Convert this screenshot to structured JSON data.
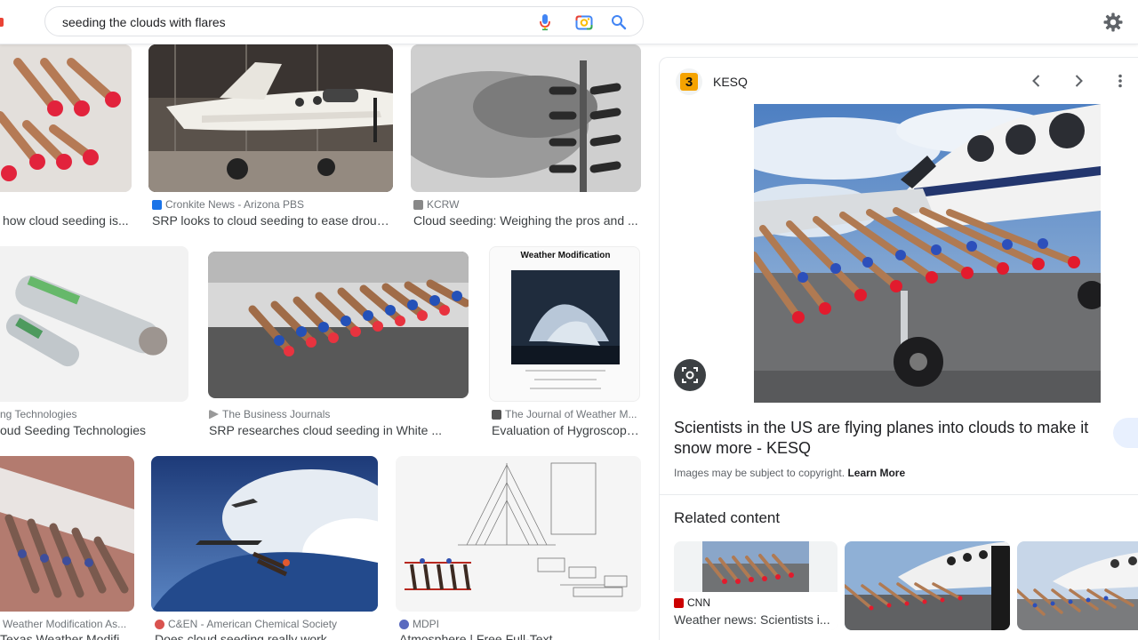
{
  "search": {
    "query": "seeding the clouds with flares"
  },
  "results": [
    {
      "source": "",
      "title": "how cloud seeding is..."
    },
    {
      "source": "Cronkite News - Arizona PBS",
      "title": "SRP looks to cloud seeding to ease droug..."
    },
    {
      "source": "KCRW",
      "title": "Cloud seeding: Weighing the pros and ..."
    },
    {
      "source": "ng Technologies",
      "title": "oud Seeding Technologies"
    },
    {
      "source": "The Business Journals",
      "title": "SRP researches cloud seeding in White ..."
    },
    {
      "source": "The Journal of Weather M...",
      "title": "Evaluation of Hygroscopi..."
    },
    {
      "source": "Weather Modification As...",
      "title": "Texas Weather Modific..."
    },
    {
      "source": "C&EN - American Chemical Society",
      "title": "Does cloud seeding really work ..."
    },
    {
      "source": "MDPI",
      "title": "Atmosphere | Free Full-Text ..."
    }
  ],
  "thumb_text": {
    "journal_title": "Weather Modification"
  },
  "panel": {
    "site": "KESQ",
    "logo_text": "3",
    "title": "Scientists in the US are flying planes into clouds to make it snow more - KESQ",
    "copyright_text": "Images may be subject to copyright.",
    "learn_more": "Learn More",
    "related_heading": "Related content",
    "related": [
      {
        "source": "CNN",
        "title": "Weather news: Scientists i..."
      }
    ]
  },
  "colors": {
    "accent": "#1a73e8",
    "cnn_red": "#cc0000",
    "text_gray": "#70757a"
  },
  "icons": [
    "mic-icon",
    "camera-icon",
    "search-icon",
    "settings-gear-icon",
    "chevron-left-icon",
    "chevron-right-icon",
    "more-vert-icon",
    "lens-icon"
  ]
}
